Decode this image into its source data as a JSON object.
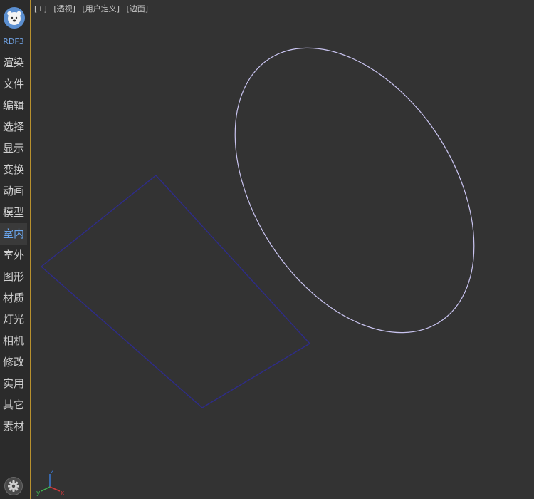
{
  "brand": "RDF3",
  "sidebar": {
    "items": [
      {
        "label": "渲染"
      },
      {
        "label": "文件"
      },
      {
        "label": "编辑"
      },
      {
        "label": "选择"
      },
      {
        "label": "显示"
      },
      {
        "label": "变换"
      },
      {
        "label": "动画"
      },
      {
        "label": "模型"
      },
      {
        "label": "室内",
        "active": true
      },
      {
        "label": "室外"
      },
      {
        "label": "图形"
      },
      {
        "label": "材质"
      },
      {
        "label": "灯光"
      },
      {
        "label": "相机"
      },
      {
        "label": "修改"
      },
      {
        "label": "实用"
      },
      {
        "label": "其它"
      },
      {
        "label": "素材"
      }
    ]
  },
  "viewport": {
    "labels": [
      "[+]",
      "[透视]",
      "[用户定义]",
      "[边面]"
    ]
  },
  "axis": {
    "x": "x",
    "y": "y",
    "z": "z"
  },
  "colors": {
    "accent_border": "#b8912e",
    "active_text": "#6aa6ee",
    "ellipse_stroke": "#c9c4f0",
    "rect_stroke": "#2e2c8a",
    "viewport_bg": "#333333"
  },
  "icons": {
    "logo": "bear-face-icon",
    "settings": "gear-icon"
  }
}
